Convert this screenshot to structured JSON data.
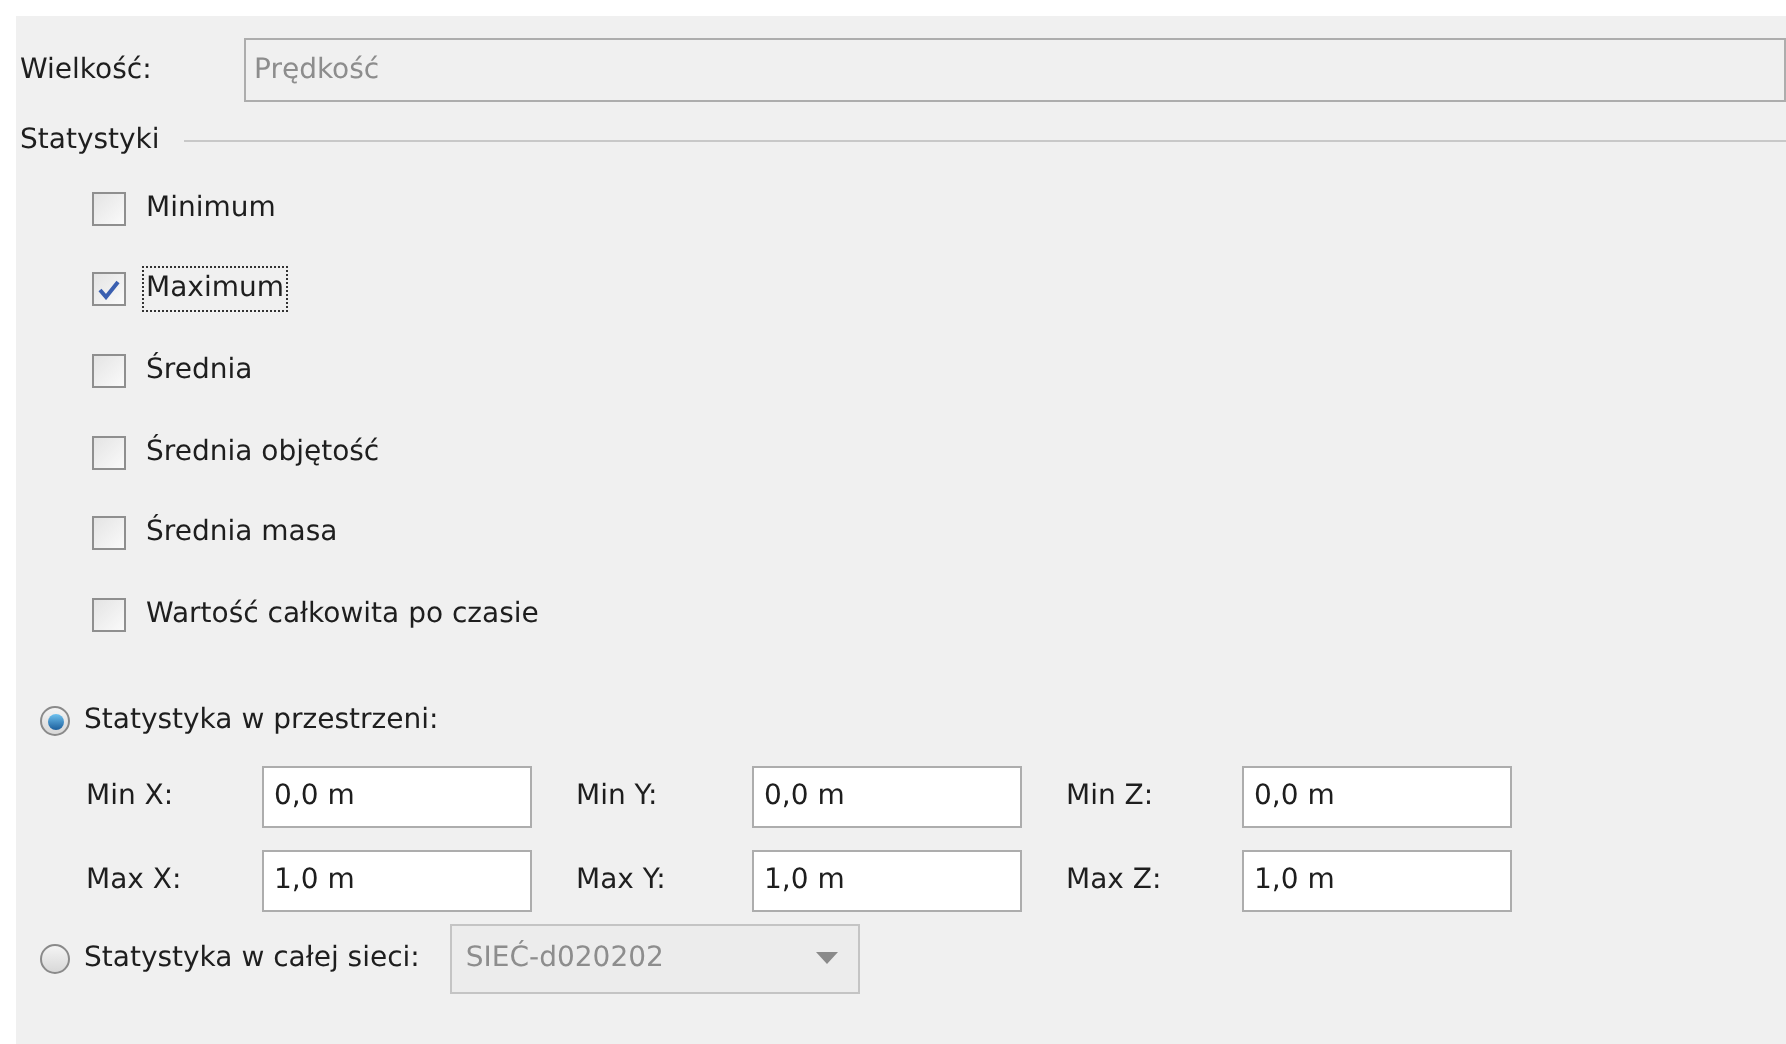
{
  "quantity": {
    "label": "Wielkość:",
    "value": "Prędkość",
    "disabled": true
  },
  "statistics": {
    "title": "Statystyki",
    "options": [
      {
        "label": "Minimum",
        "checked": false,
        "focused": false
      },
      {
        "label": "Maximum",
        "checked": true,
        "focused": true
      },
      {
        "label": "Średnia",
        "checked": false,
        "focused": false
      },
      {
        "label": "Średnia objętość",
        "checked": false,
        "focused": false
      },
      {
        "label": "Średnia masa",
        "checked": false,
        "focused": false
      },
      {
        "label": "Wartość całkowita po czasie",
        "checked": false,
        "focused": false
      }
    ]
  },
  "spatial": {
    "label": "Statystyka w przestrzeni:",
    "selected": true,
    "rows": [
      [
        {
          "label": "Min X:",
          "value": "0,0 m"
        },
        {
          "label": "Min Y:",
          "value": "0,0 m"
        },
        {
          "label": "Min Z:",
          "value": "0,0 m"
        }
      ],
      [
        {
          "label": "Max X:",
          "value": "1,0 m"
        },
        {
          "label": "Max Y:",
          "value": "1,0 m"
        },
        {
          "label": "Max Z:",
          "value": "1,0 m"
        }
      ]
    ]
  },
  "whole_mesh": {
    "label": "Statystyka w całej sieci:",
    "selected": false,
    "dropdown": {
      "value": "SIEĆ-d020202",
      "disabled": true
    }
  }
}
